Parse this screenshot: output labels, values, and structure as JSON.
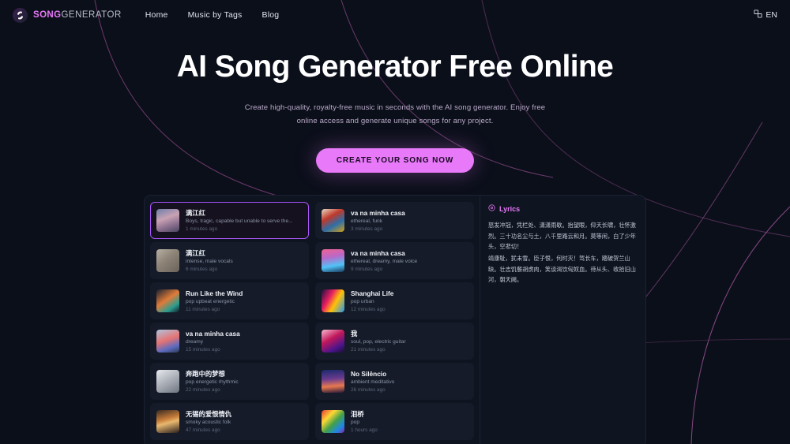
{
  "header": {
    "brand_song": "SONG",
    "brand_generator": "GENERATOR",
    "logo_icon": "swirl-disc-icon",
    "nav": [
      {
        "label": "Home"
      },
      {
        "label": "Music by Tags"
      },
      {
        "label": "Blog"
      }
    ],
    "language": {
      "icon": "translate-icon",
      "label": "EN"
    }
  },
  "hero": {
    "title": "AI Song Generator Free Online",
    "subtitle": "Create high-quality, royalty-free music in seconds with the AI song generator. Enjoy free online access and generate unique songs for any project.",
    "cta_label": "CREATE YOUR SONG NOW"
  },
  "songs": [
    {
      "title": "满江红",
      "tags": "Boys, tragic, capable but unable to serve the...",
      "time": "1 minutes ago",
      "selected": true,
      "thumb": "linear-gradient(160deg,#6b7fa8 0%,#c9a2b4 40%,#8a6f8e 70%,#4a4660 100%)"
    },
    {
      "title": "va na minha casa",
      "tags": "ethereal, funk",
      "time": "3 minutes ago",
      "selected": false,
      "thumb": "linear-gradient(150deg,#e8ddc8 0%,#c0392b 35%,#2d6ea8 65%,#d4a017 100%)"
    },
    {
      "title": "满江红",
      "tags": "intense, male vocals",
      "time": "6 minutes ago",
      "selected": false,
      "thumb": "linear-gradient(140deg,#b8b0a4 0%,#8d8377 45%,#6a625a 100%)"
    },
    {
      "title": "va na minha casa",
      "tags": "ethereal, dreamy, male voice",
      "time": "9 minutes ago",
      "selected": false,
      "thumb": "linear-gradient(170deg,#f06292 0%,#ba68c8 35%,#4fc3f7 70%,#1a3a5c 100%)"
    },
    {
      "title": "Run Like the Wind",
      "tags": "pop upbeat energetic",
      "time": "11 minutes ago",
      "selected": false,
      "thumb": "linear-gradient(145deg,#1a2230 0%,#e07b39 45%,#2a9d8f 75%,#141a26 100%)"
    },
    {
      "title": "Shanghai Life",
      "tags": "pop urban",
      "time": "12 minutes ago",
      "selected": false,
      "thumb": "linear-gradient(120deg,#1b1040 0%,#e91e63 35%,#ffc107 60%,#2196f3 100%)"
    },
    {
      "title": "va na minha casa",
      "tags": "dreamy",
      "time": "15 minutes ago",
      "selected": false,
      "thumb": "linear-gradient(160deg,#b0c4de 0%,#e57373 45%,#5c6bc0 75%,#2e3b55 100%)"
    },
    {
      "title": "我",
      "tags": "soul, pop, electric guitar",
      "time": "21 minutes ago",
      "selected": false,
      "thumb": "linear-gradient(150deg,#f8bbd0 0%,#c2185b 40%,#4a148c 75%,#1a1030 100%)"
    },
    {
      "title": "奔跑中的梦想",
      "tags": "pop energetic rhythmic",
      "time": "22 minutes ago",
      "selected": false,
      "thumb": "linear-gradient(150deg,#e8eaed 0%,#b0b5bd 45%,#6f7580 100%)"
    },
    {
      "title": "No Silêncio",
      "tags": "ambient meditativo",
      "time": "26 minutes ago",
      "selected": false,
      "thumb": "linear-gradient(175deg,#1a2a6c 0%,#6a3b8f 40%,#e8794f 70%,#2b1a38 100%)"
    },
    {
      "title": "无锡的爱恨情仇",
      "tags": "smoky acoustic folk",
      "time": "47 minutes ago",
      "selected": false,
      "thumb": "linear-gradient(165deg,#3a2a20 0%,#c87d3a 40%,#e8b870 55%,#2a1f1a 100%)"
    },
    {
      "title": "泪桥",
      "tags": "pop",
      "time": "1 hours ago",
      "selected": false,
      "thumb": "linear-gradient(135deg,#e53935 0%,#fdd835 30%,#43a047 55%,#1e88e5 80%,#8e24aa 100%)"
    }
  ],
  "lyrics": {
    "icon": "music-disc-icon",
    "heading": "Lyrics",
    "lines": [
      "怒发冲冠，凭栏处、潇潇雨歇。抬望眼，仰天长啸，壮怀激烈。三十功名尘与土，八千里路云和月。莫等闲，白了少年头，空悲切！",
      "靖康耻，犹未雪。臣子恨，何时灭！驾长车，踏破贺兰山缺。壮志饥餐胡虏肉，笑谈渴饮匈奴血。待从头、收拾旧山河，朝天阙。"
    ]
  }
}
